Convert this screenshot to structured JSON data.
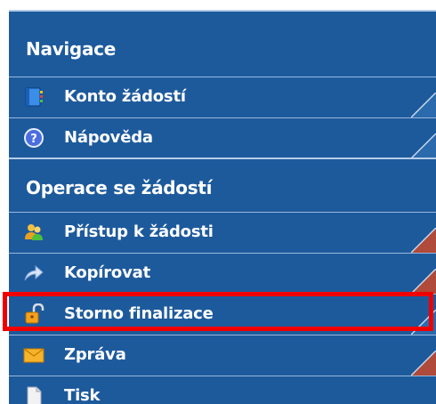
{
  "sections": [
    {
      "title": "Navigace",
      "items": [
        {
          "label": "Konto žádostí",
          "icon": "notebook-icon"
        },
        {
          "label": "Nápověda",
          "icon": "help-icon"
        }
      ]
    },
    {
      "title": "Operace se žádostí",
      "items": [
        {
          "label": "Přístup k žádosti",
          "icon": "users-icon"
        },
        {
          "label": "Kopírovat",
          "icon": "arrow-forward-icon"
        },
        {
          "label": "Storno finalizace",
          "icon": "unlock-icon"
        },
        {
          "label": "Zpráva",
          "icon": "envelope-icon"
        },
        {
          "label": "Tisk",
          "icon": "document-icon"
        }
      ]
    }
  ],
  "colors": {
    "panel": "#1d5a9c",
    "separator": "#b7cde6",
    "highlight": "#f00000",
    "corner": "#b04a3a"
  }
}
